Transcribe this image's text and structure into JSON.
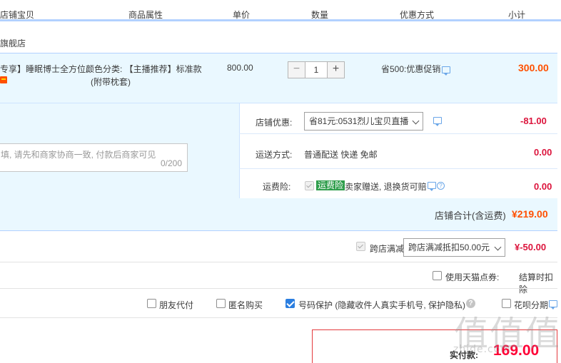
{
  "header": {
    "col_item": "店铺宝贝",
    "col_attr": "商品属性",
    "col_price": "单价",
    "col_qty": "数量",
    "col_discount": "优惠方式",
    "col_subtotal": "小计"
  },
  "shop": {
    "name": "旗舰店"
  },
  "item": {
    "title_line1": "专享】睡眠博士全方位...",
    "attr_line1": "颜色分类: 【主播推荐】标准款",
    "attr_line2": "(附带枕套)",
    "price": "800.00",
    "qty_minus": "−",
    "quantity": "1",
    "qty_plus": "+",
    "discount": "省500:优惠促销",
    "subtotal": "300.00"
  },
  "memo": {
    "placeholder": "填, 请先和商家协商一致, 付款后商家可见",
    "counter": "0/200"
  },
  "shop_discount": {
    "label": "店铺优惠:",
    "selected": "省81元:0531烈儿宝贝直播",
    "amount": "-81.00"
  },
  "shipping": {
    "label": "运送方式:",
    "value": "普通配送 快递 免邮",
    "amount": "0.00"
  },
  "insurance": {
    "label": "运费险:",
    "tag": "运费险",
    "desc": "卖家赠送, 退换货可赔",
    "amount": "0.00"
  },
  "shop_total": {
    "label": "店铺合计(含运费)",
    "amount": "¥219.00"
  },
  "cross_store": {
    "label": "跨店满减",
    "selected": "跨店满减抵扣50.00元",
    "amount": "¥-50.00"
  },
  "tmall_coupon": {
    "label": "使用天猫点券:",
    "note": "结算时扣除"
  },
  "options": {
    "friend_pay": "朋友代付",
    "anonymous": "匿名购买",
    "number_protect": "号码保护 (隐藏收件人真实手机号, 保护隐私)",
    "huabei": "花呗分期"
  },
  "payment": {
    "label": "实付款:",
    "amount": "169.00"
  },
  "watermark": {
    "main": "值值值",
    "sub": "zhide.com"
  },
  "colors": {
    "accent_blue": "#b2d1ff",
    "row_bg": "#eaf8ff",
    "price_orange": "#ff5000",
    "money_red": "#dc143c"
  }
}
